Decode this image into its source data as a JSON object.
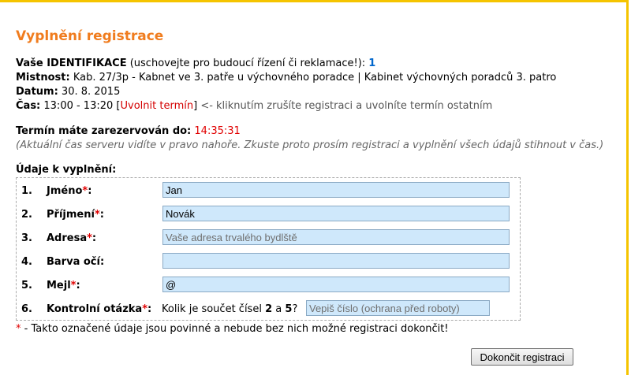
{
  "title": "Vyplnění registrace",
  "identification": {
    "label": "Vaše IDENTIFIKACE",
    "hint": "(uschovejte pro budoucí řízení či reklamace!):",
    "value": "1"
  },
  "room": {
    "label": "Mistnost:",
    "value": "Kab. 27/3p - Kabnet ve 3. patře u výchovného poradce | Kabinet výchovných poradců 3. patro"
  },
  "date": {
    "label": "Datum:",
    "value": "30. 8. 2015"
  },
  "time": {
    "label": "Čas:",
    "value": "13:00 - 13:20",
    "release_link": "Uvolnit termín",
    "release_hint": "<- kliknutím zrušíte registraci a uvolníte termín ostatním"
  },
  "reservation": {
    "label": "Termín máte zarezervován do:",
    "until": "14:35:31",
    "note": "(Aktuální čas serveru vidíte v pravo nahoře. Zkuste proto prosím registraci a vyplnění všech údajů stihnout v čas.)"
  },
  "form": {
    "section_title": "Údaje k vyplnění:",
    "fields": [
      {
        "num": "1.",
        "label": "Jméno",
        "required": "*",
        "value": "Jan",
        "placeholder": ""
      },
      {
        "num": "2.",
        "label": "Příjmení",
        "required": "*",
        "value": "Novák",
        "placeholder": ""
      },
      {
        "num": "3.",
        "label": "Adresa",
        "required": "*",
        "value": "",
        "placeholder": "Vaše adresa trvalého bydlště"
      },
      {
        "num": "4.",
        "label": "Barva očí",
        "required": "",
        "value": "",
        "placeholder": ""
      },
      {
        "num": "5.",
        "label": "Mejl",
        "required": "*",
        "value": "@",
        "placeholder": ""
      }
    ],
    "captcha": {
      "num": "6.",
      "label": "Kontrolní otázka",
      "required": "*",
      "question_prefix": "Kolik je součet čísel",
      "a": "2",
      "conj": "a",
      "b": "5",
      "qmark": "?",
      "placeholder": "Vepiš číslo (ochrana před roboty)"
    },
    "required_star": "*",
    "footnote": "- Takto označené údaje jsou povinné a nebude bez nich možné registraci dokončit!",
    "colon": ":"
  },
  "submit_label": "Dokončit registraci",
  "colors": {
    "accent": "#f07c1e",
    "required": "#e00000",
    "input_bg": "#cfe8fb",
    "frame": "#f5c400"
  }
}
